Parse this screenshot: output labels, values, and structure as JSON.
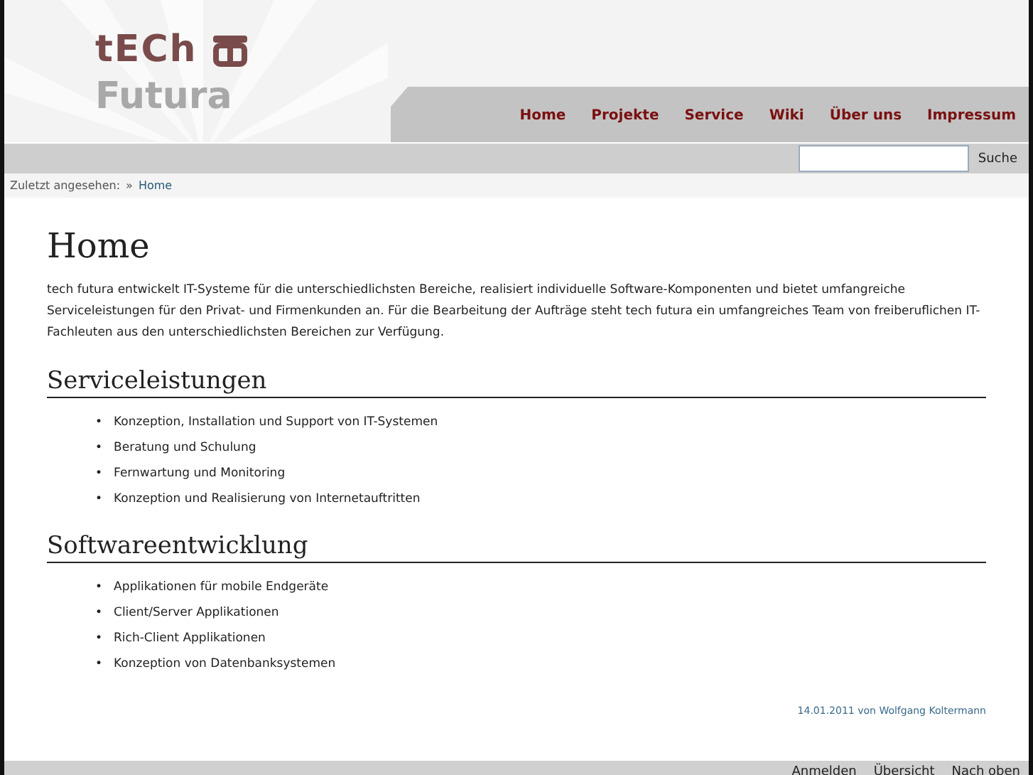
{
  "logo": {
    "line_1": "tECh",
    "line_2": "Futura"
  },
  "nav": [
    {
      "label": "Home",
      "selected": false
    },
    {
      "label": "Projekte",
      "selected": false
    },
    {
      "label": "Service",
      "selected": false
    },
    {
      "label": "Wiki",
      "selected": false
    },
    {
      "label": "Über uns",
      "selected": false
    },
    {
      "label": "Impressum",
      "selected": false
    }
  ],
  "search": {
    "button": "Suche"
  },
  "breadcrumb": {
    "label": "Zuletzt angesehen:",
    "separator": "»",
    "link": "Home"
  },
  "page_title": "Home",
  "intro": "tech futura entwickelt IT-Systeme für die unterschiedlichsten Bereiche, realisiert individuelle Software-Komponenten und bietet umfangreiche Serviceleistungen für den Privat- und Firmenkunden an. Für die Bearbeitung der Aufträge steht tech futura ein umfangreiches Team von freiberuflichen IT-Fachleuten aus den unterschiedlichsten Bereichen zur Verfügung.",
  "sections": [
    {
      "heading": "Serviceleistungen",
      "bullet": "•",
      "items": [
        "Konzeption, Installation und Support von IT-Systemen",
        "Beratung und Schulung",
        "Fernwartung und Monitoring",
        "Konzeption und Realisierung von Internetauftritten"
      ]
    },
    {
      "heading": "Softwareentwicklung",
      "bullet": "•",
      "items": [
        "Applikationen für mobile Endgeräte",
        "Client/Server Applikationen",
        "Rich-Client Applikationen",
        "Konzeption von Datenbanksystemen"
      ]
    }
  ],
  "meta": "14.01.2011 von Wolfgang Koltermann",
  "footer": [
    "Anmelden",
    "Übersicht",
    "Nach oben"
  ]
}
